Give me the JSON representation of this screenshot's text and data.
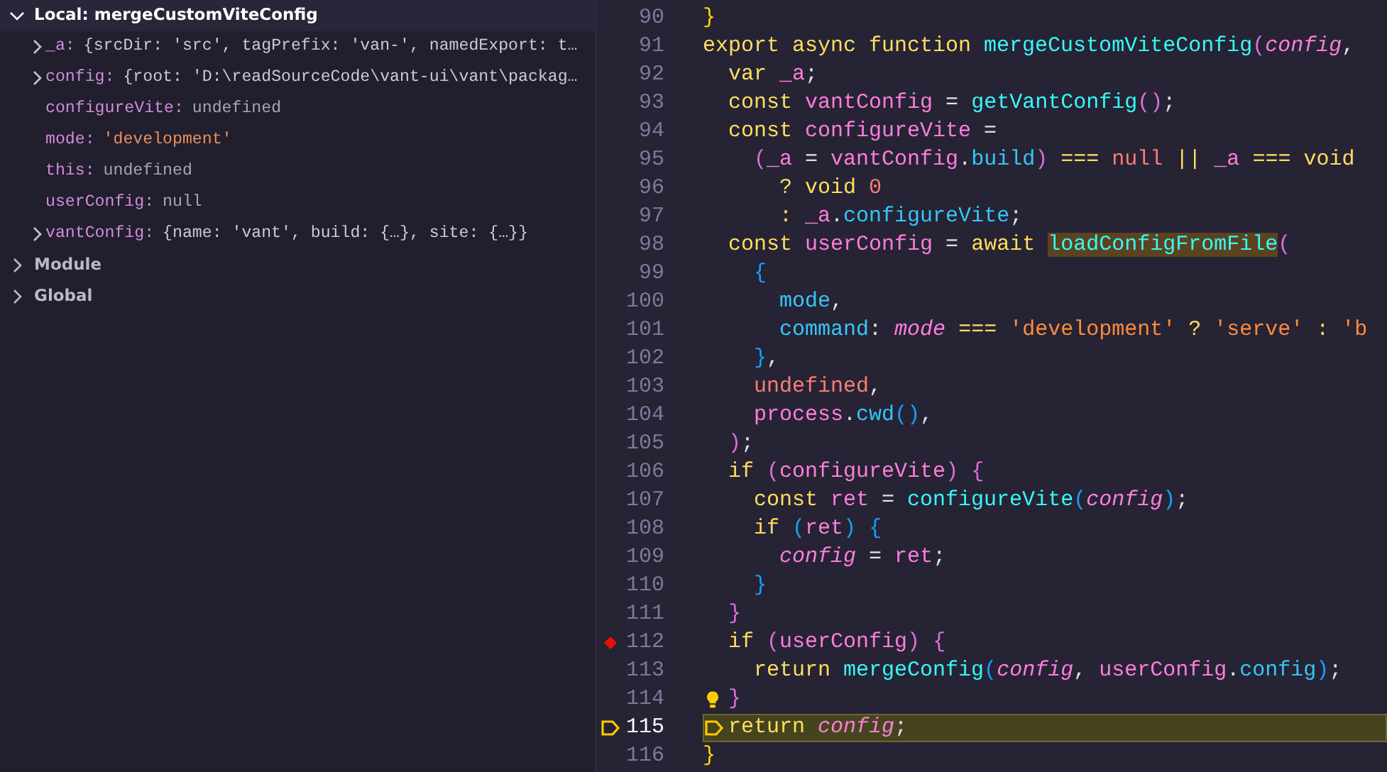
{
  "variables_panel": {
    "scopes": [
      {
        "label": "Local: mergeCustomViteConfig",
        "expanded": true,
        "variables": [
          {
            "name": "_a:",
            "value": "{srcDir: 'src', tagPrefix: 'van-', namedExport: t…",
            "kind": "object",
            "expandable": true
          },
          {
            "name": "config:",
            "value": "{root: 'D:\\readSourceCode\\vant-ui\\vant\\packag…",
            "kind": "object",
            "expandable": true
          },
          {
            "name": "configureVite:",
            "value": "undefined",
            "kind": "empty",
            "expandable": false
          },
          {
            "name": "mode:",
            "value": "'development'",
            "kind": "string",
            "expandable": false
          },
          {
            "name": "this:",
            "value": "undefined",
            "kind": "empty",
            "expandable": false
          },
          {
            "name": "userConfig:",
            "value": "null",
            "kind": "empty",
            "expandable": false
          },
          {
            "name": "vantConfig:",
            "value": "{name: 'vant', build: {…}, site: {…}}",
            "kind": "object",
            "expandable": true
          }
        ]
      },
      {
        "label": "Module",
        "expanded": false
      },
      {
        "label": "Global",
        "expanded": false
      }
    ]
  },
  "editor": {
    "lines": [
      {
        "number": "90",
        "breakpoint": false,
        "current": false,
        "lightbulb": false,
        "tokens": [
          {
            "text": "}",
            "kind": "b1"
          }
        ]
      },
      {
        "number": "91",
        "breakpoint": false,
        "current": false,
        "lightbulb": false,
        "tokens": [
          {
            "text": "export",
            "kind": "kw"
          },
          {
            "text": " async",
            "kind": "kw"
          },
          {
            "text": " function",
            "kind": "kw"
          },
          {
            "text": " mergeCustomViteConfig",
            "kind": "fn"
          },
          {
            "text": "(",
            "kind": "b2"
          },
          {
            "text": "config",
            "kind": "param"
          },
          {
            "text": ",",
            "kind": "punct"
          }
        ]
      },
      {
        "number": "92",
        "breakpoint": false,
        "current": false,
        "lightbulb": false,
        "tokens": [
          {
            "text": "  var",
            "kind": "kw"
          },
          {
            "text": " _a",
            "kind": "var"
          },
          {
            "text": ";",
            "kind": "punct"
          }
        ]
      },
      {
        "number": "93",
        "breakpoint": false,
        "current": false,
        "lightbulb": false,
        "tokens": [
          {
            "text": "  const",
            "kind": "kw"
          },
          {
            "text": " vantConfig",
            "kind": "var"
          },
          {
            "text": " =",
            "kind": "punct"
          },
          {
            "text": " getVantConfig",
            "kind": "fn"
          },
          {
            "text": "()",
            "kind": "b2"
          },
          {
            "text": ";",
            "kind": "punct"
          }
        ]
      },
      {
        "number": "94",
        "breakpoint": false,
        "current": false,
        "lightbulb": false,
        "tokens": [
          {
            "text": "  const",
            "kind": "kw"
          },
          {
            "text": " configureVite",
            "kind": "var"
          },
          {
            "text": " =",
            "kind": "punct"
          }
        ]
      },
      {
        "number": "95",
        "breakpoint": false,
        "current": false,
        "lightbulb": false,
        "tokens": [
          {
            "text": "    (",
            "kind": "b2"
          },
          {
            "text": "_a",
            "kind": "var"
          },
          {
            "text": " =",
            "kind": "punct"
          },
          {
            "text": " vantConfig",
            "kind": "var"
          },
          {
            "text": ".",
            "kind": "punct"
          },
          {
            "text": "build",
            "kind": "prop"
          },
          {
            "text": ")",
            "kind": "b2"
          },
          {
            "text": " ===",
            "kind": "op"
          },
          {
            "text": " null",
            "kind": "lit"
          },
          {
            "text": " ||",
            "kind": "op"
          },
          {
            "text": " _a",
            "kind": "var"
          },
          {
            "text": " ===",
            "kind": "op"
          },
          {
            "text": " void",
            "kind": "kw"
          }
        ]
      },
      {
        "number": "96",
        "breakpoint": false,
        "current": false,
        "lightbulb": false,
        "tokens": [
          {
            "text": "      ?",
            "kind": "op"
          },
          {
            "text": " void",
            "kind": "kw"
          },
          {
            "text": " 0",
            "kind": "lit"
          }
        ]
      },
      {
        "number": "97",
        "breakpoint": false,
        "current": false,
        "lightbulb": false,
        "tokens": [
          {
            "text": "      :",
            "kind": "op"
          },
          {
            "text": " _a",
            "kind": "var"
          },
          {
            "text": ".",
            "kind": "punct"
          },
          {
            "text": "configureVite",
            "kind": "prop"
          },
          {
            "text": ";",
            "kind": "punct"
          }
        ]
      },
      {
        "number": "98",
        "breakpoint": false,
        "current": false,
        "lightbulb": false,
        "tokens": [
          {
            "text": "  const",
            "kind": "kw"
          },
          {
            "text": " userConfig",
            "kind": "var"
          },
          {
            "text": " =",
            "kind": "punct"
          },
          {
            "text": " await ",
            "kind": "kw"
          },
          {
            "text": "loadConfigFromFile",
            "kind": "fnhl"
          },
          {
            "text": "(",
            "kind": "b2"
          }
        ]
      },
      {
        "number": "99",
        "breakpoint": false,
        "current": false,
        "lightbulb": false,
        "tokens": [
          {
            "text": "    {",
            "kind": "b3"
          }
        ]
      },
      {
        "number": "100",
        "breakpoint": false,
        "current": false,
        "lightbulb": false,
        "tokens": [
          {
            "text": "      mode",
            "kind": "prop"
          },
          {
            "text": ",",
            "kind": "punct"
          }
        ]
      },
      {
        "number": "101",
        "breakpoint": false,
        "current": false,
        "lightbulb": false,
        "tokens": [
          {
            "text": "      command",
            "kind": "prop"
          },
          {
            "text": ":",
            "kind": "punct"
          },
          {
            "text": " mode",
            "kind": "param"
          },
          {
            "text": " ===",
            "kind": "op"
          },
          {
            "text": " 'development'",
            "kind": "str"
          },
          {
            "text": " ?",
            "kind": "op"
          },
          {
            "text": " 'serve'",
            "kind": "str"
          },
          {
            "text": " :",
            "kind": "op"
          },
          {
            "text": " 'b",
            "kind": "str"
          }
        ]
      },
      {
        "number": "102",
        "breakpoint": false,
        "current": false,
        "lightbulb": false,
        "tokens": [
          {
            "text": "    }",
            "kind": "b3"
          },
          {
            "text": ",",
            "kind": "punct"
          }
        ]
      },
      {
        "number": "103",
        "breakpoint": false,
        "current": false,
        "lightbulb": false,
        "tokens": [
          {
            "text": "    undefined",
            "kind": "lit"
          },
          {
            "text": ",",
            "kind": "punct"
          }
        ]
      },
      {
        "number": "104",
        "breakpoint": false,
        "current": false,
        "lightbulb": false,
        "tokens": [
          {
            "text": "    process",
            "kind": "var"
          },
          {
            "text": ".",
            "kind": "punct"
          },
          {
            "text": "cwd",
            "kind": "prop"
          },
          {
            "text": "()",
            "kind": "b3"
          },
          {
            "text": ",",
            "kind": "punct"
          }
        ]
      },
      {
        "number": "105",
        "breakpoint": false,
        "current": false,
        "lightbulb": false,
        "tokens": [
          {
            "text": "  )",
            "kind": "b2"
          },
          {
            "text": ";",
            "kind": "punct"
          }
        ]
      },
      {
        "number": "106",
        "breakpoint": false,
        "current": false,
        "lightbulb": false,
        "tokens": [
          {
            "text": "  if",
            "kind": "kw"
          },
          {
            "text": " (",
            "kind": "b2"
          },
          {
            "text": "configureVite",
            "kind": "var"
          },
          {
            "text": ")",
            "kind": "b2"
          },
          {
            "text": " {",
            "kind": "b2"
          }
        ]
      },
      {
        "number": "107",
        "breakpoint": false,
        "current": false,
        "lightbulb": false,
        "tokens": [
          {
            "text": "    const",
            "kind": "kw"
          },
          {
            "text": " ret",
            "kind": "var"
          },
          {
            "text": " =",
            "kind": "punct"
          },
          {
            "text": " configureVite",
            "kind": "fn"
          },
          {
            "text": "(",
            "kind": "b3"
          },
          {
            "text": "config",
            "kind": "param"
          },
          {
            "text": ")",
            "kind": "b3"
          },
          {
            "text": ";",
            "kind": "punct"
          }
        ]
      },
      {
        "number": "108",
        "breakpoint": false,
        "current": false,
        "lightbulb": false,
        "tokens": [
          {
            "text": "    if",
            "kind": "kw"
          },
          {
            "text": " (",
            "kind": "b3"
          },
          {
            "text": "ret",
            "kind": "var"
          },
          {
            "text": ")",
            "kind": "b3"
          },
          {
            "text": " {",
            "kind": "b3"
          }
        ]
      },
      {
        "number": "109",
        "breakpoint": false,
        "current": false,
        "lightbulb": false,
        "tokens": [
          {
            "text": "      config",
            "kind": "param"
          },
          {
            "text": " =",
            "kind": "punct"
          },
          {
            "text": " ret",
            "kind": "var"
          },
          {
            "text": ";",
            "kind": "punct"
          }
        ]
      },
      {
        "number": "110",
        "breakpoint": false,
        "current": false,
        "lightbulb": false,
        "tokens": [
          {
            "text": "    }",
            "kind": "b3"
          }
        ]
      },
      {
        "number": "111",
        "breakpoint": false,
        "current": false,
        "lightbulb": false,
        "tokens": [
          {
            "text": "  }",
            "kind": "b2"
          }
        ]
      },
      {
        "number": "112",
        "breakpoint": true,
        "current": false,
        "lightbulb": false,
        "tokens": [
          {
            "text": "  if",
            "kind": "kw"
          },
          {
            "text": " (",
            "kind": "b2"
          },
          {
            "text": "userConfig",
            "kind": "var"
          },
          {
            "text": ")",
            "kind": "b2"
          },
          {
            "text": " {",
            "kind": "b2"
          }
        ]
      },
      {
        "number": "113",
        "breakpoint": false,
        "current": false,
        "lightbulb": false,
        "tokens": [
          {
            "text": "    return",
            "kind": "kw"
          },
          {
            "text": " mergeConfig",
            "kind": "fn"
          },
          {
            "text": "(",
            "kind": "b3"
          },
          {
            "text": "config",
            "kind": "param"
          },
          {
            "text": ",",
            "kind": "punct"
          },
          {
            "text": " userConfig",
            "kind": "var"
          },
          {
            "text": ".",
            "kind": "punct"
          },
          {
            "text": "config",
            "kind": "prop"
          },
          {
            "text": ")",
            "kind": "b3"
          },
          {
            "text": ";",
            "kind": "punct"
          }
        ]
      },
      {
        "number": "114",
        "breakpoint": false,
        "current": false,
        "lightbulb": true,
        "tokens": [
          {
            "text": "  }",
            "kind": "b2"
          }
        ]
      },
      {
        "number": "115",
        "breakpoint": false,
        "current": true,
        "lightbulb": false,
        "tokens": [
          {
            "text": "  return",
            "kind": "kw"
          },
          {
            "text": " config",
            "kind": "param"
          },
          {
            "text": ";",
            "kind": "punct"
          }
        ]
      },
      {
        "number": "116",
        "breakpoint": false,
        "current": false,
        "lightbulb": false,
        "tokens": [
          {
            "text": "}",
            "kind": "b1"
          }
        ]
      }
    ]
  }
}
